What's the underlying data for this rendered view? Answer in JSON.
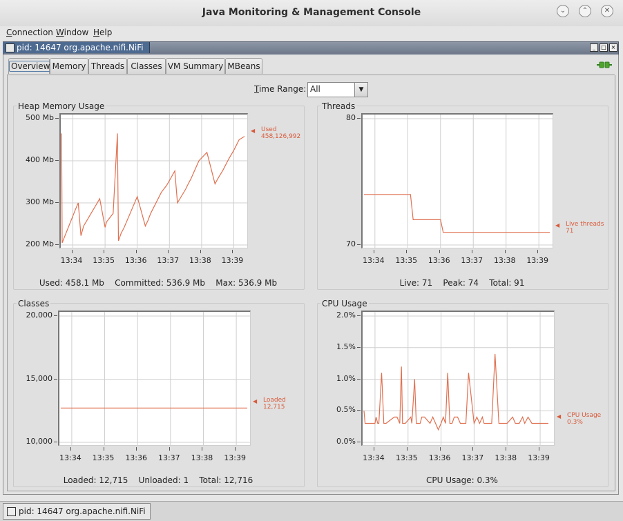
{
  "window": {
    "title": "Java Monitoring & Management Console"
  },
  "menu": {
    "items": [
      {
        "prefix": "C",
        "rest": "onnection"
      },
      {
        "prefix": "W",
        "rest": "indow"
      },
      {
        "prefix": "H",
        "rest": "elp"
      }
    ]
  },
  "connection": {
    "tab_label": "pid: 14647 org.apache.nifi.NiFi"
  },
  "tabs": [
    {
      "label": "Overview",
      "selected": true
    },
    {
      "label": "Memory"
    },
    {
      "label": "Threads"
    },
    {
      "label": "Classes"
    },
    {
      "label": "VM Summary"
    },
    {
      "label": "MBeans"
    }
  ],
  "time_range": {
    "label": "Time Range:",
    "label_mnemonic": "T",
    "label_rest": "ime Range:",
    "value": "All"
  },
  "time_ticks": [
    "13:34",
    "13:35",
    "13:36",
    "13:37",
    "13:38",
    "13:39"
  ],
  "line_color": "#e07050",
  "heap": {
    "title": "Heap Memory Usage",
    "y_ticks": [
      "500 Mb",
      "400 Mb",
      "300 Mb",
      "200 Mb"
    ],
    "annotation": {
      "name": "Used",
      "value": "458,126,992"
    },
    "summary": "Used: 458.1 Mb    Committed: 536.9 Mb    Max: 536.9 Mb"
  },
  "threads": {
    "title": "Threads",
    "y_ticks": [
      "80",
      "70"
    ],
    "annotation": {
      "name": "Live threads",
      "value": "71"
    },
    "summary": "Live: 71    Peak: 74    Total: 91"
  },
  "classes": {
    "title": "Classes",
    "y_ticks": [
      "20,000",
      "15,000",
      "10,000"
    ],
    "annotation": {
      "name": "Loaded",
      "value": "12,715"
    },
    "summary": "Loaded: 12,715    Unloaded: 1    Total: 12,716"
  },
  "cpu": {
    "title": "CPU Usage",
    "y_ticks": [
      "2.0%",
      "1.5%",
      "1.0%",
      "0.5%",
      "0.0%"
    ],
    "annotation": {
      "name": "CPU Usage",
      "value": "0.3%"
    },
    "summary": "CPU Usage: 0.3%"
  },
  "chart_data": [
    {
      "type": "line",
      "title": "Heap Memory Usage",
      "ylim": [
        200,
        500
      ],
      "xlim": [
        "13:33:40",
        "13:39:20"
      ],
      "series": [
        {
          "name": "Used",
          "x": [
            "13:33:39",
            "13:33:40",
            "13:34:05",
            "13:34:10",
            "13:34:15",
            "13:34:20",
            "13:34:50",
            "13:35:00",
            "13:35:03",
            "13:35:15",
            "13:35:23",
            "13:35:25",
            "13:35:30",
            "13:35:35",
            "13:35:45",
            "13:36:00",
            "13:36:15",
            "13:36:20",
            "13:36:25",
            "13:36:45",
            "13:36:55",
            "13:37:00",
            "13:37:10",
            "13:37:15",
            "13:37:30",
            "13:37:35",
            "13:37:40",
            "13:37:55",
            "13:38:10",
            "13:38:25",
            "13:38:30",
            "13:38:40",
            "13:38:50",
            "13:39:00",
            "13:39:10",
            "13:39:20"
          ],
          "values": [
            465,
            205,
            285,
            300,
            222,
            245,
            310,
            242,
            255,
            275,
            465,
            210,
            228,
            240,
            270,
            315,
            245,
            258,
            275,
            325,
            342,
            353,
            376,
            300,
            332,
            345,
            357,
            400,
            420,
            345,
            357,
            378,
            403,
            425,
            450,
            458
          ]
        }
      ]
    },
    {
      "type": "line",
      "title": "Threads",
      "ylim": [
        70,
        80
      ],
      "xlim": [
        "13:33:40",
        "13:39:20"
      ],
      "series": [
        {
          "name": "Live threads",
          "x": [
            "13:33:40",
            "13:35:05",
            "13:35:10",
            "13:36:00",
            "13:36:05",
            "13:39:20"
          ],
          "values": [
            74,
            74,
            72,
            72,
            71,
            71
          ]
        }
      ]
    },
    {
      "type": "line",
      "title": "Classes",
      "ylim": [
        10000,
        20000
      ],
      "xlim": [
        "13:33:40",
        "13:39:20"
      ],
      "series": [
        {
          "name": "Loaded",
          "x": [
            "13:33:40",
            "13:39:20"
          ],
          "values": [
            12715,
            12715
          ]
        }
      ]
    },
    {
      "type": "line",
      "title": "CPU Usage",
      "ylim": [
        0,
        2.0
      ],
      "xlim": [
        "13:33:40",
        "13:39:20"
      ],
      "series": [
        {
          "name": "CPU Usage",
          "x": [
            "13:33:40",
            "13:33:42",
            "13:34:00",
            "13:34:02",
            "13:34:05",
            "13:34:07",
            "13:34:12",
            "13:34:16",
            "13:34:20",
            "13:34:35",
            "13:34:40",
            "13:34:45",
            "13:34:48",
            "13:34:50",
            "13:34:55",
            "13:35:05",
            "13:35:07",
            "13:35:12",
            "13:35:15",
            "13:35:20",
            "13:35:22",
            "13:35:25",
            "13:35:30",
            "13:35:40",
            "13:35:45",
            "13:35:50",
            "13:35:55",
            "13:36:00",
            "13:36:04",
            "13:36:08",
            "13:36:12",
            "13:36:16",
            "13:36:20",
            "13:36:24",
            "13:36:30",
            "13:36:35",
            "13:36:45",
            "13:36:50",
            "13:37:00",
            "13:37:05",
            "13:37:10",
            "13:37:15",
            "13:37:18",
            "13:37:22",
            "13:37:28",
            "13:37:32",
            "13:37:38",
            "13:37:45",
            "13:38:00",
            "13:38:10",
            "13:38:15",
            "13:38:22",
            "13:38:28",
            "13:38:32",
            "13:38:38",
            "13:38:45",
            "13:38:52",
            "13:38:58",
            "13:39:05",
            "13:39:15"
          ],
          "values": [
            0.5,
            0.3,
            0.3,
            0.4,
            0.3,
            0.3,
            1.1,
            0.3,
            0.3,
            0.4,
            0.4,
            0.3,
            1.2,
            0.3,
            0.3,
            0.4,
            0.3,
            1.0,
            0.3,
            0.3,
            0.3,
            0.4,
            0.4,
            0.3,
            0.4,
            0.3,
            0.2,
            0.3,
            0.4,
            0.3,
            1.1,
            0.3,
            0.3,
            0.4,
            0.4,
            0.3,
            0.3,
            1.1,
            0.3,
            0.4,
            0.3,
            0.4,
            0.3,
            0.3,
            0.3,
            0.3,
            1.4,
            0.3,
            0.3,
            0.4,
            0.3,
            0.3,
            0.4,
            0.3,
            0.4,
            0.3,
            0.3,
            0.3,
            0.3,
            0.3
          ]
        }
      ]
    }
  ]
}
